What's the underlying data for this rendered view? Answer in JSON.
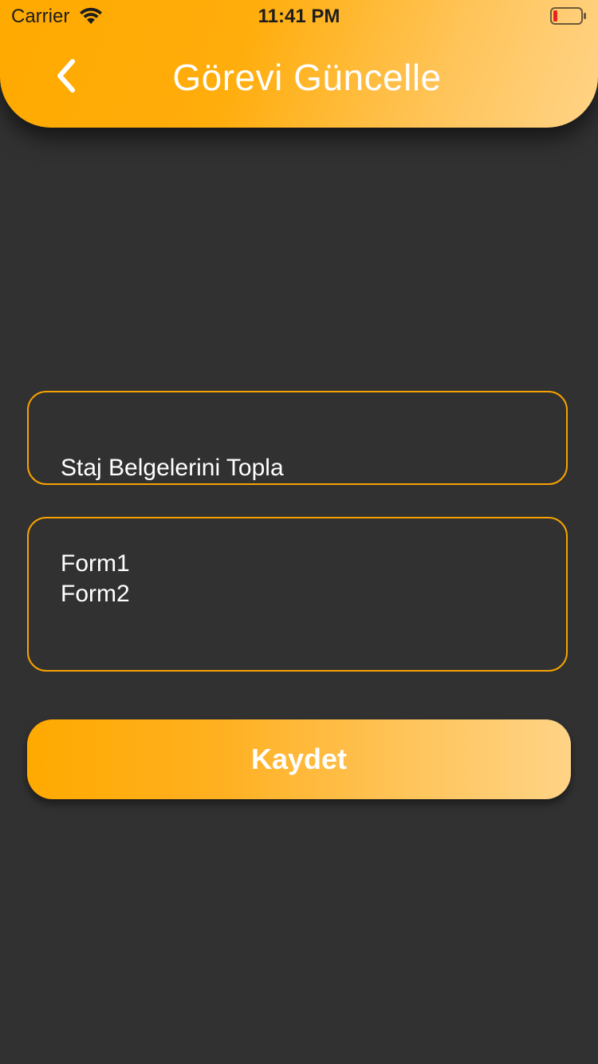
{
  "status_bar": {
    "carrier": "Carrier",
    "time": "11:41 PM",
    "battery_level": 0.15
  },
  "header": {
    "title": "Görevi Güncelle",
    "back_icon": "chevron-left-icon"
  },
  "form": {
    "title_value": "Staj Belgelerini Topla",
    "title_icon": "books-icon",
    "description_value": "Form1\nForm2",
    "save_label": "Kaydet"
  },
  "colors": {
    "accent": "#ffaa00",
    "accent_light": "#ffd386",
    "background": "#313131",
    "field_border": "#f8a200",
    "text": "#ffffff"
  }
}
